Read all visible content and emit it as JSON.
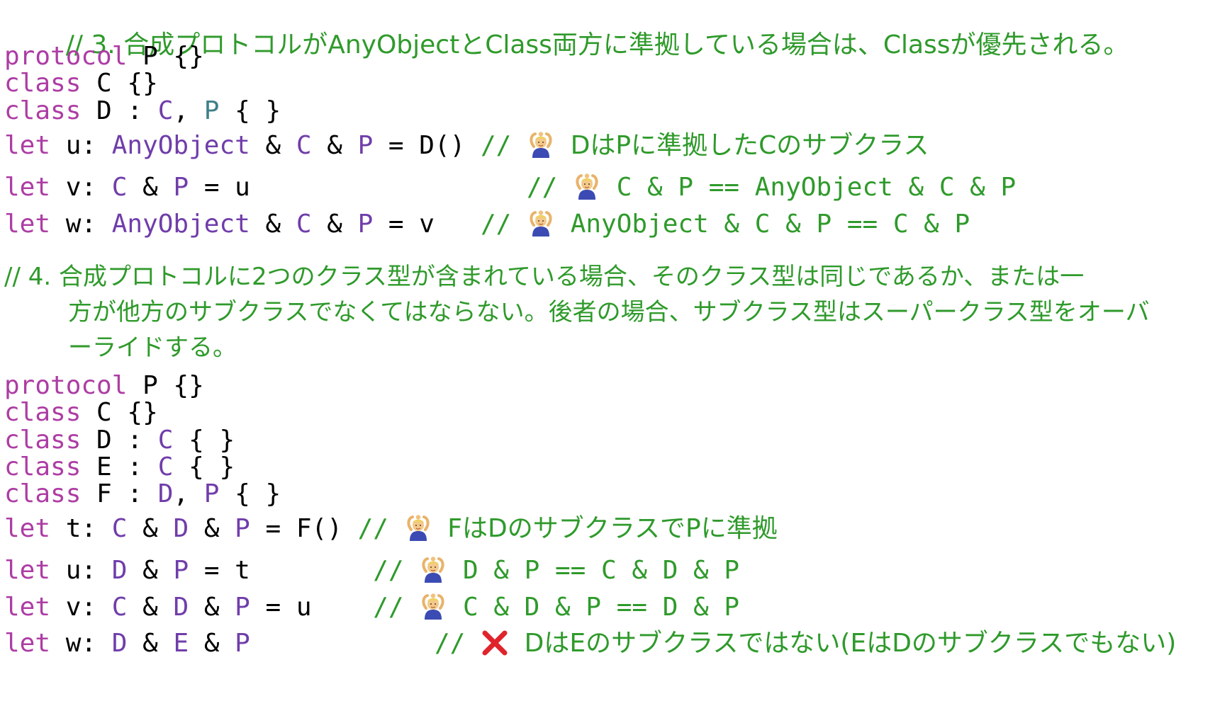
{
  "section3": {
    "heading": "// 3. 合成プロトコルがAnyObjectとClass両方に準拠している場合は、Classが優先される。",
    "code": [
      [
        "protocol",
        " P {}"
      ],
      [
        "class",
        " C {}"
      ],
      [
        "class",
        " D : ",
        "C",
        ", ",
        "P",
        " { }"
      ]
    ],
    "lets": [
      {
        "kw": "let",
        "name": " u: ",
        "types": "AnyObject",
        "rest1": " & ",
        "t2": "C",
        "rest2": " & ",
        "t3": "P",
        "rest3": " = D() ",
        "comment_prefix": "// ",
        "icon": "ok-gesture-icon",
        "comment": "DはPに準拠したCのサブクラス"
      },
      {
        "kw": "let",
        "name": " v: ",
        "t1": "C",
        "r1": " & ",
        "t2": "P",
        "r2": " = u                  ",
        "comment_prefix": "// ",
        "icon": "ok-gesture-icon",
        "comment": "C & P == AnyObject & C & P"
      },
      {
        "kw": "let",
        "name": " w: ",
        "t1": "AnyObject",
        "r1": " & ",
        "t2": "C",
        "r2": " & ",
        "t3": "P",
        "r3": " = v   ",
        "comment_prefix": "// ",
        "icon": "ok-gesture-icon",
        "comment": "AnyObject & C & P == C & P"
      }
    ]
  },
  "section4": {
    "heading_line1": "// 4. 合成プロトコルに2つのクラス型が含まれている場合、そのクラス型は同じであるか、または一",
    "heading_line2": "方が他方のサブクラスでなくてはならない。後者の場合、サブクラス型はスーパークラス型をオーバ",
    "heading_line3": "ーライドする。",
    "code": {
      "l1_kw": "protocol",
      "l1_rest": " P {}",
      "l2_kw": "class",
      "l2_rest": " C {}",
      "l3_kw": "class",
      "l3_a": " D : ",
      "l3_t": "C",
      "l3_b": " { }",
      "l4_kw": "class",
      "l4_a": " E : ",
      "l4_t": "C",
      "l4_b": " { }",
      "l5_kw": "class",
      "l5_a": " F : ",
      "l5_t1": "D",
      "l5_b": ", ",
      "l5_t2": "P",
      "l5_c": " { }"
    },
    "lets": {
      "t_kw": "let",
      "t_name": " t: ",
      "t_t1": "C",
      "t_r1": " & ",
      "t_t2": "D",
      "t_r2": " & ",
      "t_t3": "P",
      "t_r3": " = F() ",
      "t_cp": "// ",
      "t_comment": "FはDのサブクラスでPに準拠",
      "u_kw": "let",
      "u_name": " u: ",
      "u_t1": "D",
      "u_r1": " & ",
      "u_t2": "P",
      "u_r2": " = t        ",
      "u_cp": "// ",
      "u_comment": "D & P == C & D & P",
      "v_kw": "let",
      "v_name": " v: ",
      "v_t1": "C",
      "v_r1": " & ",
      "v_t2": "D",
      "v_r2": " & ",
      "v_t3": "P",
      "v_r3": " = u    ",
      "v_cp": "// ",
      "v_comment": "C & D & P == D & P",
      "w_kw": "let",
      "w_name": " w: ",
      "w_t1": "D",
      "w_r1": " & ",
      "w_t2": "E",
      "w_r2": " & ",
      "w_t3": "P",
      "w_r3": "            ",
      "w_cp": "// ",
      "w_comment": "DはEのサブクラスではない(EはDのサブクラスでもない)"
    },
    "icons": {
      "ok": "ok-gesture-icon",
      "ng": "cross-mark-icon"
    }
  },
  "colors": {
    "keyword": "#ad3da4",
    "type": "#703daa",
    "type_alt": "#3e8087",
    "comment": "#2f9a2b",
    "plain": "#000000"
  }
}
